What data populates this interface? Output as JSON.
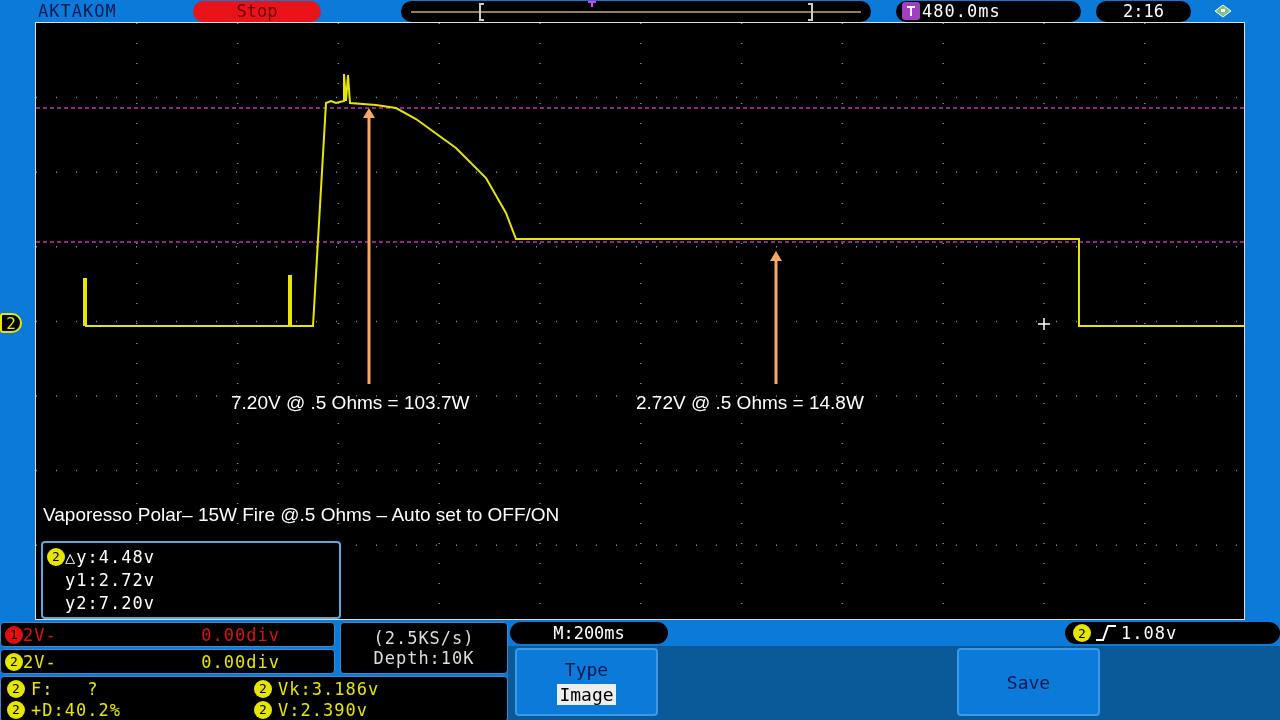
{
  "top_bar": {
    "brand": "AKTAKOM",
    "run_state": "Stop",
    "trigger_time": "480.0ms",
    "clock": "2:16"
  },
  "channel_marker": "2",
  "annotations": [
    {
      "text": "7.20V @ .5 Ohms = 103.7W"
    },
    {
      "text": "2.72V @ .5 Ohms = 14.8W"
    }
  ],
  "caption": "Vaporesso Polar– 15W Fire @.5 Ohms – Auto set to OFF/ON",
  "cursor_readout": {
    "channel": "2",
    "lines": [
      "△y:4.48v",
      "y1:2.72v",
      "y2:7.20v"
    ]
  },
  "channels": [
    {
      "number": "1",
      "scale": "2V-",
      "offset": "0.00div",
      "color": "#e01010"
    },
    {
      "number": "2",
      "scale": "2V-",
      "offset": "0.00div",
      "color": "#e6e600"
    }
  ],
  "acquisition": {
    "sample_rate": "(2.5KS/s)",
    "depth": "Depth:10K"
  },
  "timebase": "M:200ms",
  "trigger": {
    "channel": "2",
    "level": "1.08v"
  },
  "measurements": [
    {
      "channel": "2",
      "text": "F:   ?"
    },
    {
      "channel": "2",
      "text": "Vk:3.186v"
    },
    {
      "channel": "2",
      "text": "+D:40.2%"
    },
    {
      "channel": "2",
      "text": "V:2.390v"
    }
  ],
  "menu_buttons": [
    {
      "kind": "option",
      "label": "Type",
      "value": "Image"
    },
    {
      "kind": "action",
      "label": "Save"
    }
  ]
}
